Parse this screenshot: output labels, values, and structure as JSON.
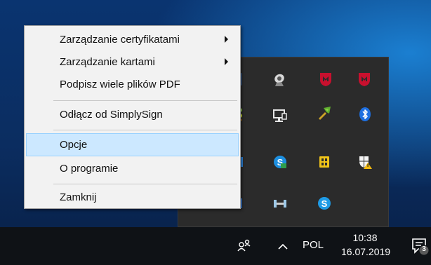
{
  "menu": {
    "items": [
      {
        "label": "Zarządzanie certyfikatami",
        "submenu": true
      },
      {
        "label": "Zarządzanie kartami",
        "submenu": true
      },
      {
        "label": "Podpisz wiele plików PDF",
        "submenu": false
      },
      {
        "label": "Odłącz od SimplySign",
        "submenu": false
      },
      {
        "label": "Opcje",
        "submenu": false,
        "highlighted": true
      },
      {
        "label": "O programie",
        "submenu": false
      },
      {
        "label": "Zamknij",
        "submenu": false
      }
    ]
  },
  "tray": {
    "icons": [
      "partial-blue-icon",
      "satellite-dish-icon",
      "mcafee-shield-icon",
      "mcafee-shield-icon",
      "partial-colored-icon",
      "network-monitor-icon",
      "green-tool-icon",
      "bluetooth-icon",
      "partial-blue-icon",
      "skype-business-icon",
      "sim-card-icon",
      "security-warning-shield-icon",
      "partial-blue-icon",
      "vpn-connector-icon",
      "skype-icon"
    ]
  },
  "taskbar": {
    "language": "POL",
    "time": "10:38",
    "date": "16.07.2019",
    "notification_count": "3",
    "icons": [
      "people-icon",
      "chevron-up-icon",
      "action-center-icon"
    ]
  },
  "colors": {
    "menu_highlight": "#cce8ff",
    "menu_highlight_border": "#99d1ff",
    "taskbar": "#0f1216",
    "tray_panel": "#2b2b2b"
  }
}
